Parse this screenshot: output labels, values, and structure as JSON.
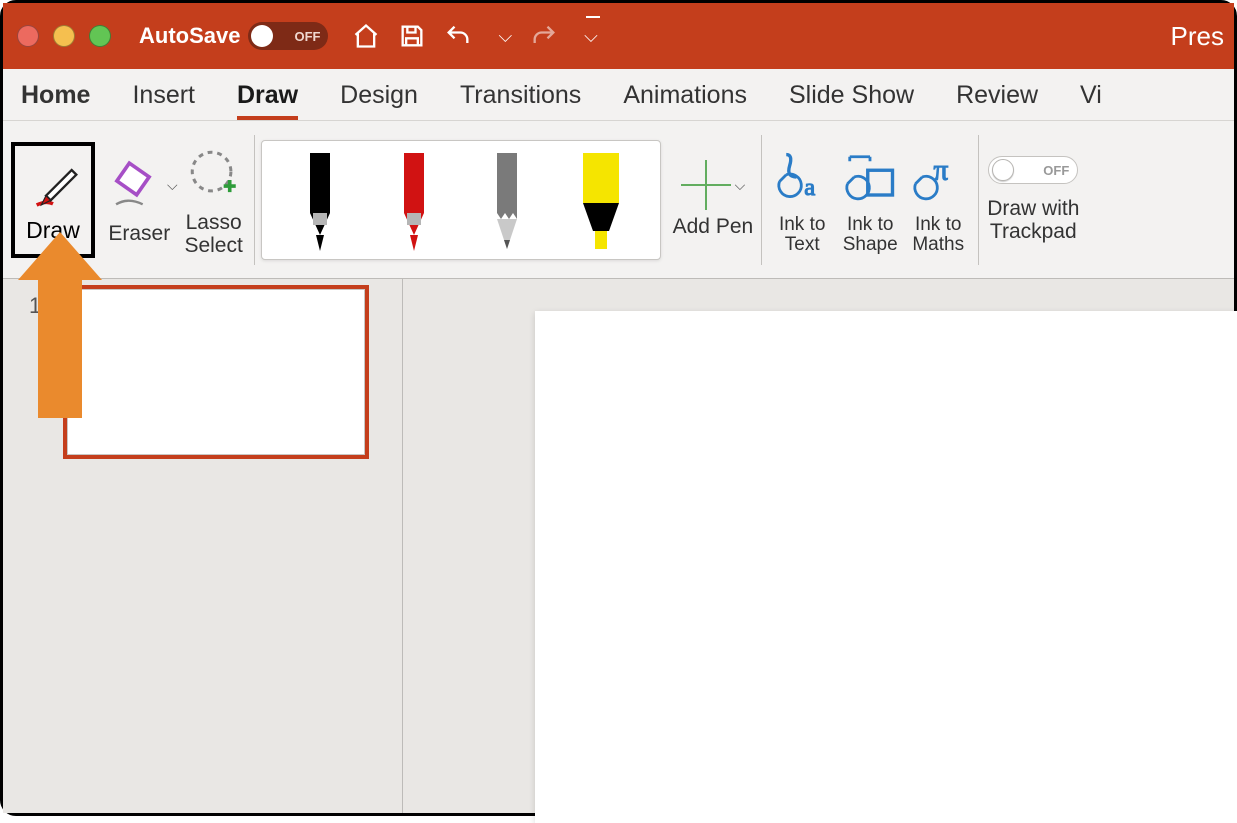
{
  "titlebar": {
    "autosave_label": "AutoSave",
    "autosave_state": "OFF",
    "document_title": "Pres"
  },
  "tabs": [
    {
      "label": "Home"
    },
    {
      "label": "Insert"
    },
    {
      "label": "Draw",
      "active": true
    },
    {
      "label": "Design"
    },
    {
      "label": "Transitions"
    },
    {
      "label": "Animations"
    },
    {
      "label": "Slide Show"
    },
    {
      "label": "Review"
    },
    {
      "label": "Vi"
    }
  ],
  "ribbon": {
    "draw_button": "Draw",
    "eraser": "Eraser",
    "lasso": "Lasso\nSelect",
    "pens": [
      {
        "color": "#000000",
        "tip": "pen"
      },
      {
        "color": "#d11212",
        "tip": "pen"
      },
      {
        "color": "#7a7a7a",
        "tip": "pencil"
      },
      {
        "color": "#f5e500",
        "tip": "highlighter"
      }
    ],
    "add_pen": "Add Pen",
    "ink_to_text": "Ink to\nText",
    "ink_to_shape": "Ink to\nShape",
    "ink_to_maths": "Ink to\nMaths",
    "trackpad_state": "OFF",
    "trackpad_label": "Draw with\nTrackpad"
  },
  "thumbrail": {
    "slide_number": "1"
  },
  "annotation": {
    "highlight_target": "draw_button",
    "arrow_color": "#ea8a2d"
  }
}
